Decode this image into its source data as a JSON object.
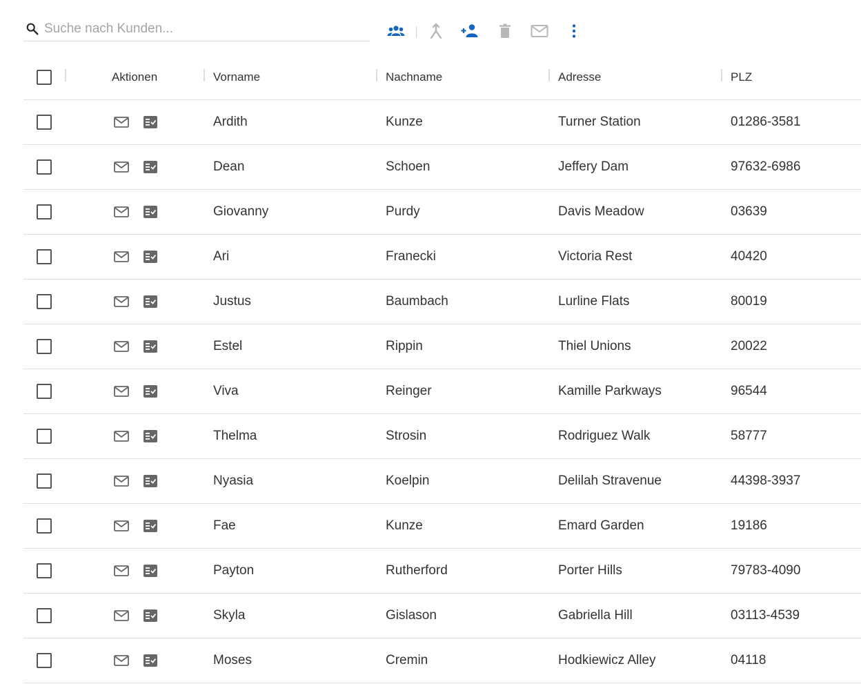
{
  "search": {
    "placeholder": "Suche nach Kunden..."
  },
  "toolbar": {
    "icons": [
      "group-icon",
      "merge-icon",
      "add-person-icon",
      "delete-icon",
      "mail-icon",
      "more-vert-icon"
    ],
    "colors": {
      "active": "#1565c0",
      "disabled": "#b7b7b7"
    }
  },
  "table": {
    "columns": [
      "Aktionen",
      "Vorname",
      "Nachname",
      "Adresse",
      "PLZ"
    ],
    "rows": [
      {
        "vorname": "Ardith",
        "nachname": "Kunze",
        "adresse": "Turner Station",
        "plz": "01286-3581"
      },
      {
        "vorname": "Dean",
        "nachname": "Schoen",
        "adresse": "Jeffery Dam",
        "plz": "97632-6986"
      },
      {
        "vorname": "Giovanny",
        "nachname": "Purdy",
        "adresse": "Davis Meadow",
        "plz": "03639"
      },
      {
        "vorname": "Ari",
        "nachname": "Franecki",
        "adresse": "Victoria Rest",
        "plz": "40420"
      },
      {
        "vorname": "Justus",
        "nachname": "Baumbach",
        "adresse": "Lurline Flats",
        "plz": "80019"
      },
      {
        "vorname": "Estel",
        "nachname": "Rippin",
        "adresse": "Thiel Unions",
        "plz": "20022"
      },
      {
        "vorname": "Viva",
        "nachname": "Reinger",
        "adresse": "Kamille Parkways",
        "plz": "96544"
      },
      {
        "vorname": "Thelma",
        "nachname": "Strosin",
        "adresse": "Rodriguez Walk",
        "plz": "58777"
      },
      {
        "vorname": "Nyasia",
        "nachname": "Koelpin",
        "adresse": "Delilah Stravenue",
        "plz": "44398-3937"
      },
      {
        "vorname": "Fae",
        "nachname": "Kunze",
        "adresse": "Emard Garden",
        "plz": "19186"
      },
      {
        "vorname": "Payton",
        "nachname": "Rutherford",
        "adresse": "Porter Hills",
        "plz": "79783-4090"
      },
      {
        "vorname": "Skyla",
        "nachname": "Gislason",
        "adresse": "Gabriella Hill",
        "plz": "03113-4539"
      },
      {
        "vorname": "Moses",
        "nachname": "Cremin",
        "adresse": "Hodkiewicz Alley",
        "plz": "04118"
      }
    ]
  }
}
